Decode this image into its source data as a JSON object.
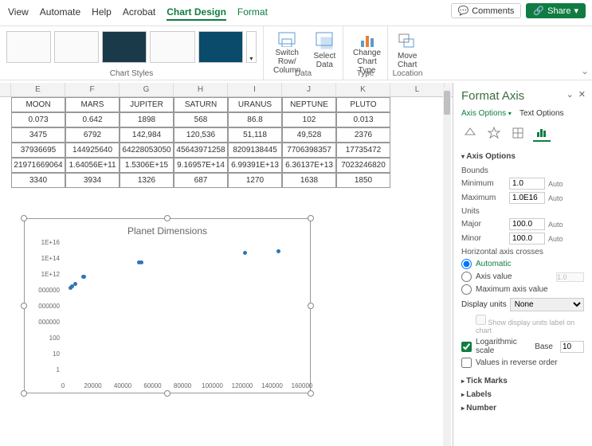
{
  "tabs": {
    "view": "View",
    "automate": "Automate",
    "help": "Help",
    "acrobat": "Acrobat",
    "chart_design": "Chart Design",
    "format": "Format"
  },
  "topbuttons": {
    "comments": "Comments",
    "share": "Share"
  },
  "ribbon": {
    "groups": {
      "chart_styles": "Chart Styles",
      "data": "Data",
      "type": "Type",
      "location": "Location"
    },
    "switch": "Switch Row/\nColumn",
    "select": "Select\nData",
    "changetype": "Change\nChart Type",
    "move": "Move\nChart"
  },
  "columns": [
    "E",
    "F",
    "G",
    "H",
    "I",
    "J",
    "K",
    "L"
  ],
  "table": {
    "headers": [
      "MOON",
      "MARS",
      "JUPITER",
      "SATURN",
      "URANUS",
      "NEPTUNE",
      "PLUTO"
    ],
    "rows": [
      [
        "0.073",
        "0.642",
        "1898",
        "568",
        "86.8",
        "102",
        "0.013"
      ],
      [
        "3475",
        "6792",
        "142,984",
        "120,536",
        "51,118",
        "49,528",
        "2376"
      ],
      [
        "37936695",
        "144925640",
        "64228053050",
        "45643971258",
        "8209138445",
        "7706398357",
        "17735472"
      ],
      [
        "21971669064",
        "1.64056E+11",
        "1.5306E+15",
        "9.16957E+14",
        "6.99391E+13",
        "6.36137E+13",
        "7023246820"
      ],
      [
        "3340",
        "3934",
        "1326",
        "687",
        "1270",
        "1638",
        "1850"
      ]
    ]
  },
  "chart_data": {
    "type": "scatter",
    "title": "Planet Dimensions",
    "xlabel": "",
    "ylabel": "",
    "xlim": [
      0,
      160000
    ],
    "ylim_log": [
      1,
      1e+16
    ],
    "x_ticks": [
      "0",
      "20000",
      "40000",
      "60000",
      "80000",
      "100000",
      "120000",
      "140000",
      "160000"
    ],
    "y_ticks": [
      "1",
      "10",
      "100",
      "000000",
      "000000",
      "000000",
      "1E+12",
      "1E+14",
      "1E+16"
    ],
    "series": [
      {
        "name": "",
        "x": [
          3475,
          4879,
          6792,
          12104,
          12756,
          49528,
          51118,
          120536,
          142984
        ],
        "y": [
          38000000000.0,
          61000000000.0,
          140000000000.0,
          930000000000.0,
          1100000000000.0,
          64000000000000.0,
          70000000000000.0,
          920000000000000.0,
          1500000000000000.0
        ]
      }
    ]
  },
  "panel": {
    "title": "Format Axis",
    "tabs": {
      "axis": "Axis Options",
      "text": "Text Options"
    },
    "sections": {
      "axis_options": "Axis Options",
      "tick": "Tick Marks",
      "labels": "Labels",
      "number": "Number"
    },
    "bounds": "Bounds",
    "min": "Minimum",
    "max": "Maximum",
    "units": "Units",
    "major": "Major",
    "minor": "Minor",
    "min_val": "1.0",
    "max_val": "1.0E16",
    "major_val": "100.0",
    "minor_val": "100.0",
    "auto": "Auto",
    "hcross": "Horizontal axis crosses",
    "automatic": "Automatic",
    "axisvalue": "Axis value",
    "axisvalue_input": "1.0",
    "maxaxis": "Maximum axis value",
    "display": "Display units",
    "none": "None",
    "showlabel": "Show display units label on chart",
    "logscale": "Logarithmic scale",
    "base": "Base",
    "base_val": "10",
    "reverse": "Values in reverse order"
  }
}
